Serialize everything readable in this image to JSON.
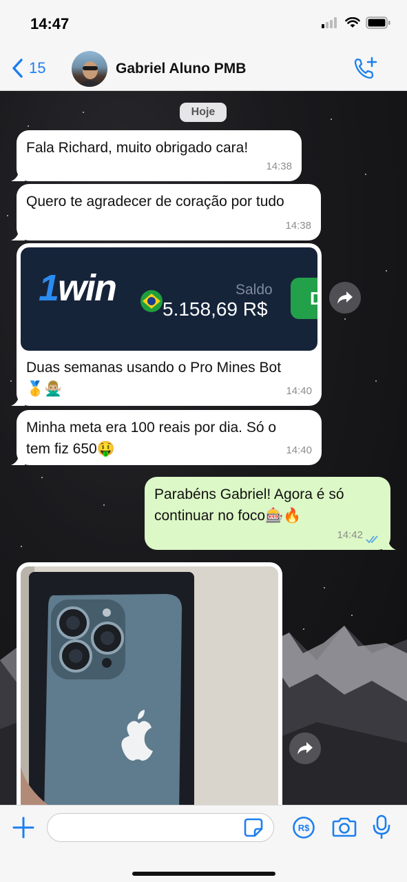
{
  "status_bar": {
    "time": "14:47"
  },
  "header": {
    "back_count": "15",
    "contact_name": "Gabriel Aluno PMB"
  },
  "chat": {
    "date_separator": "Hoje",
    "messages": [
      {
        "text": "Fala Richard, muito obrigado cara!",
        "time": "14:38"
      },
      {
        "text": "Quero te agradecer de coração por tudo",
        "time": "14:38"
      },
      {
        "text": "Duas semanas usando o Pro Mines Bot🥇🙅🏼‍♂️",
        "time": "14:40",
        "image": {
          "brand_one": "1",
          "brand_rest": "win",
          "saldo_label": "Saldo",
          "saldo_value": "5.158,69 R$",
          "button_letter": "D"
        }
      },
      {
        "text": "Minha meta era 100 reais por dia. Só o tem fiz 650🤑",
        "time": "14:40"
      },
      {
        "text": "Parabéns Gabriel! Agora é só continuar no foco🎰🔥",
        "time": "14:42",
        "read": true
      }
    ]
  },
  "input": {
    "placeholder": ""
  },
  "colors": {
    "accent": "#1b7ff0",
    "incoming": "#ffffff",
    "outgoing": "#dcf8c6",
    "read_ticks": "#53a6e8"
  }
}
